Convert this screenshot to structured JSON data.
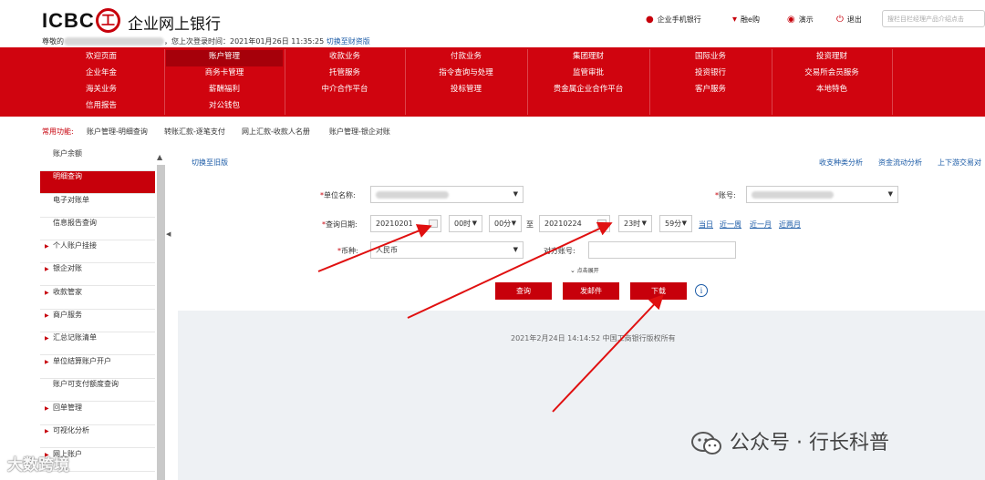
{
  "header": {
    "logo_text": "ICBC",
    "logo_seal": "工",
    "bank_name": "企业网上银行",
    "greeting": "尊敬的",
    "last_login": "，您上次登录时间：2021年01月26日 11:35:25",
    "switch_link": "切换至财资版",
    "links": {
      "mobile_bank": "企业手机银行",
      "rong_e_gou": "融e购",
      "demo": "演示",
      "logout": "退出"
    },
    "search_placeholder": "搜栏目栏经理产品介绍点击"
  },
  "nav": {
    "row1": [
      "欢迎页面",
      "账户管理",
      "收款业务",
      "付款业务",
      "集团理财",
      "国际业务",
      "投资理财"
    ],
    "row2": [
      "企业年金",
      "商务卡管理",
      "托管服务",
      "指令查询与处理",
      "监管审批",
      "投资银行",
      "交易所会员服务"
    ],
    "row3": [
      "海关业务",
      "薪酬福利",
      "中介合作平台",
      "投标管理",
      "贵金属企业合作平台",
      "客户服务",
      "本地特色"
    ],
    "row4": [
      "信用报告",
      "对公钱包"
    ],
    "active": "账户管理"
  },
  "common": {
    "label": "常用功能:",
    "items": [
      "账户管理-明细查询",
      "转账汇款-逐笔支付",
      "网上汇款-收款人名册",
      "账户管理-银企对账"
    ]
  },
  "sidebar": {
    "items": [
      "账户余额",
      "明细查询",
      "电子对账单",
      "信息报告查询",
      "个人账户挂接",
      "银企对账",
      "收款管家",
      "商户服务",
      "汇总记账清单",
      "单位结算账户开户",
      "账户可支付额度查询",
      "回单管理",
      "可视化分析",
      "网上账户"
    ]
  },
  "main": {
    "switch_old": "切换至旧版",
    "top_links": [
      "收支种类分析",
      "资金流动分析",
      "上下游交易对"
    ],
    "unit_label": "单位名称:",
    "account_label": "账号:",
    "date_label": "查询日期:",
    "start_date": "20210201",
    "start_hour": "00时",
    "start_min": "00分",
    "to": "至",
    "end_date": "20210224",
    "end_hour": "23时",
    "end_min": "59分",
    "ranges": [
      "当日",
      "近一周",
      "近一月",
      "近两月"
    ],
    "currency_label": "币种:",
    "currency_value": "人民币",
    "counter_label": "对方账号:",
    "expand": "点击展开",
    "buttons": {
      "query": "查询",
      "email": "发邮件",
      "download": "下载"
    },
    "footer": "2021年2月24日 14:14:52   中国工商银行版权所有"
  },
  "watermarks": {
    "left": "大数跨境",
    "right": "公众号 · 行长科普"
  },
  "colors": {
    "brand_red": "#c7000b",
    "nav_red": "#d0040f",
    "link_blue": "#1a5aa6",
    "annotation_red": "#e01010"
  }
}
